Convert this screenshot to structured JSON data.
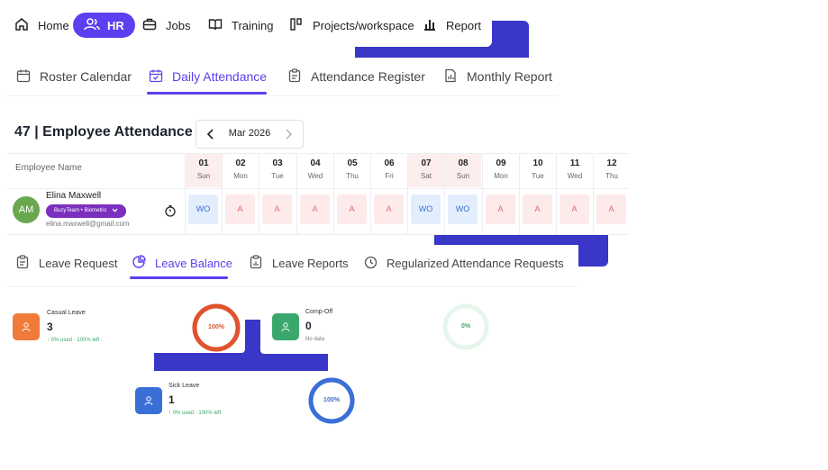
{
  "top_nav": {
    "items": [
      {
        "label": "Home",
        "icon": "home-icon"
      },
      {
        "label": "HR",
        "icon": "users-icon"
      },
      {
        "label": "Jobs",
        "icon": "briefcase-icon"
      },
      {
        "label": "Training",
        "icon": "book-icon"
      },
      {
        "label": "Projects/workspace",
        "icon": "projects-icon"
      },
      {
        "label": "Report",
        "icon": "bar-chart-icon"
      }
    ],
    "active": "HR"
  },
  "attendance_tabs": [
    {
      "label": "Roster Calendar",
      "icon": "calendar-icon"
    },
    {
      "label": "Daily Attendance",
      "icon": "calendar-check-icon"
    },
    {
      "label": "Attendance Register",
      "icon": "clipboard-icon"
    },
    {
      "label": "Monthly Report",
      "icon": "file-chart-icon"
    }
  ],
  "attendance_active_tab": "Daily Attendance",
  "attendance": {
    "title": "47 | Employee Attendance",
    "month": "Mar 2026",
    "employee_col_label": "Employee Name",
    "days": [
      {
        "d": "01",
        "w": "Sun"
      },
      {
        "d": "02",
        "w": "Mon"
      },
      {
        "d": "03",
        "w": "Tue"
      },
      {
        "d": "04",
        "w": "Wed"
      },
      {
        "d": "05",
        "w": "Thu"
      },
      {
        "d": "06",
        "w": "Fri"
      },
      {
        "d": "07",
        "w": "Sat"
      },
      {
        "d": "08",
        "w": "Sun"
      },
      {
        "d": "09",
        "w": "Mon"
      },
      {
        "d": "10",
        "w": "Tue"
      },
      {
        "d": "11",
        "w": "Wed"
      },
      {
        "d": "12",
        "w": "Thu"
      }
    ],
    "employee": {
      "initials": "AM",
      "name": "Elina Maxwell",
      "badge": "BuzyTeam • Biometric",
      "email": "elina.maxwell@gmail.com",
      "status": [
        "WO",
        "A",
        "A",
        "A",
        "A",
        "A",
        "WO",
        "WO",
        "A",
        "A",
        "A",
        "A"
      ]
    }
  },
  "leave_tabs": [
    {
      "label": "Leave Request",
      "icon": "clipboard-list-icon"
    },
    {
      "label": "Leave Balance",
      "icon": "pie-chart-icon"
    },
    {
      "label": "Leave Reports",
      "icon": "report-icon"
    },
    {
      "label": "Regularized Attendance Requests",
      "icon": "clock-history-icon"
    }
  ],
  "leave_active_tab": "Leave Balance",
  "leave_cards": [
    {
      "title": "Casual Leave",
      "value": "3",
      "sub": "0% used · 100% left",
      "ring_label": "100%",
      "fraction": 1.0,
      "color": "#e0532e",
      "icon_color": "#f07b3a"
    },
    {
      "title": "Comp-Off",
      "value": "0",
      "sub": "No data",
      "ring_label": "0%",
      "fraction": 0.0,
      "color": "#3aa76d",
      "icon_color": "#3aa76d"
    },
    {
      "title": "Sick Leave",
      "value": "1",
      "sub": "0% used · 100% left",
      "ring_label": "100%",
      "fraction": 1.0,
      "color": "#3b6fd8",
      "icon_color": "#3b6fd8"
    }
  ],
  "colors": {
    "accent": "#5b3ff0",
    "overlay_blue": "#3a36c8",
    "absent": "#e06a6a",
    "weekly_off": "#3b6fd8"
  }
}
